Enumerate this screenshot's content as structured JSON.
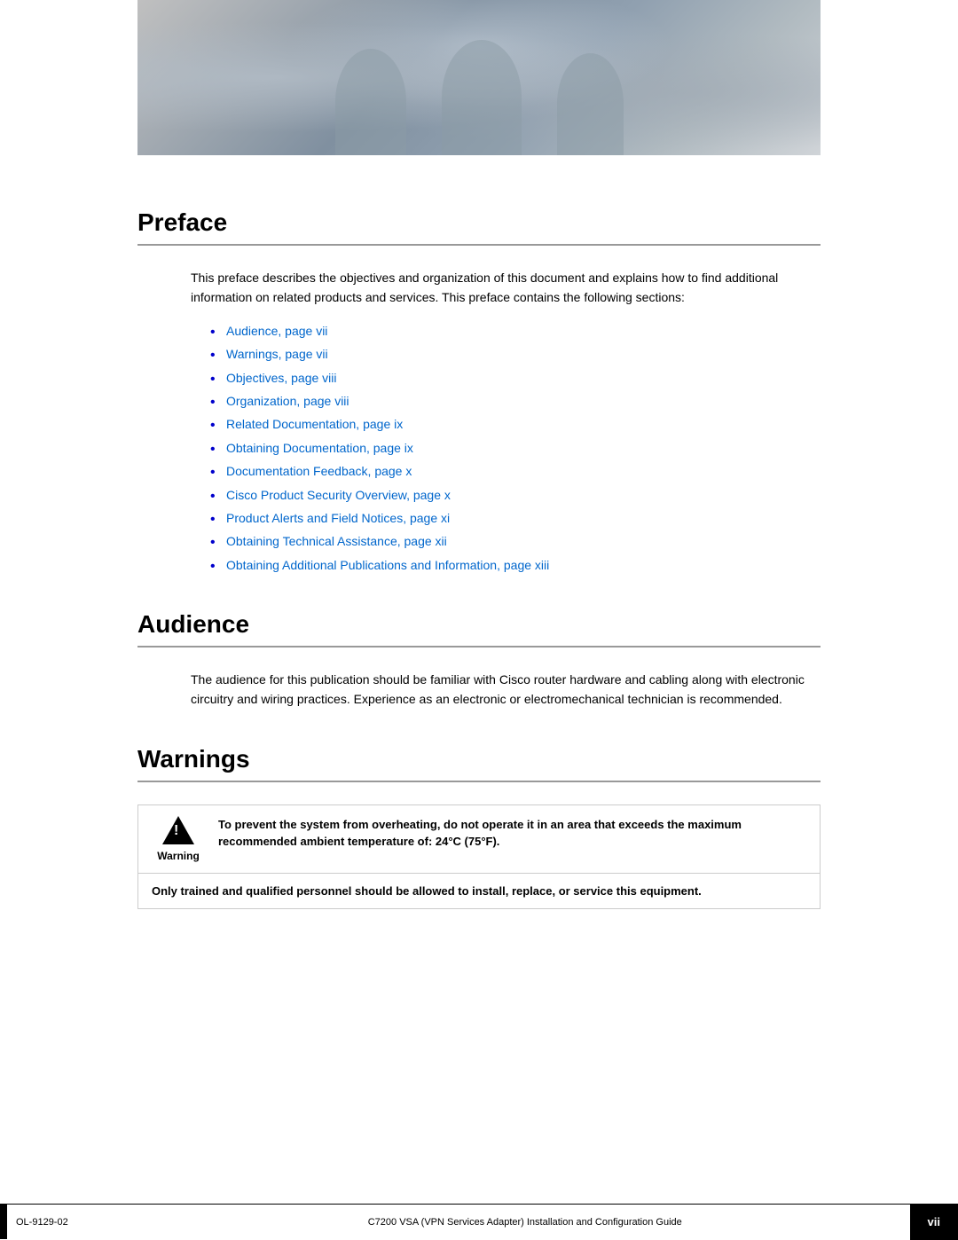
{
  "header": {
    "alt": "Cisco documentation header image with people"
  },
  "preface": {
    "title": "Preface",
    "intro": "This preface describes the objectives and organization of this document and explains how to find additional information on related products and services. This preface contains the following sections:",
    "toc_items": [
      {
        "label": "Audience, page vii"
      },
      {
        "label": "Warnings, page vii"
      },
      {
        "label": "Objectives, page viii"
      },
      {
        "label": "Organization, page viii"
      },
      {
        "label": "Related Documentation, page ix"
      },
      {
        "label": "Obtaining Documentation, page ix"
      },
      {
        "label": "Documentation Feedback, page x"
      },
      {
        "label": "Cisco Product Security Overview, page x"
      },
      {
        "label": "Product Alerts and Field Notices, page xi"
      },
      {
        "label": "Obtaining Technical Assistance, page xii"
      },
      {
        "label": "Obtaining Additional Publications and Information, page xiii"
      }
    ]
  },
  "audience": {
    "title": "Audience",
    "text": "The audience for this publication should be familiar with Cisco router hardware and cabling along with electronic circuitry and wiring practices. Experience as an electronic or electromechanical technician is recommended."
  },
  "warnings": {
    "title": "Warnings",
    "warning_label": "Warning",
    "warning_primary": "To prevent the system from overheating, do not operate it in an area that exceeds the maximum recommended ambient temperature of: 24°C (75°F).",
    "warning_secondary": "Only trained and qualified personnel should be allowed to install, replace, or service this equipment."
  },
  "footer": {
    "ol_number": "OL-9129-02",
    "doc_title": "C7200 VSA (VPN Services Adapter) Installation and Configuration Guide",
    "page_number": "vii"
  }
}
